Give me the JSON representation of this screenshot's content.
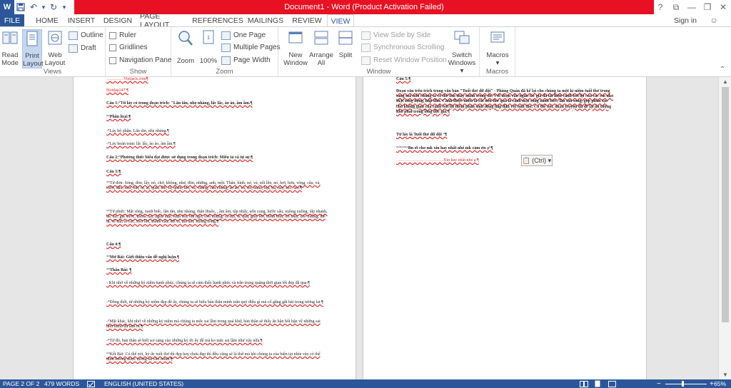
{
  "window": {
    "title": "Document1 - Word (Product Activation Failed)",
    "help": "?",
    "ribbon_display": "⧉",
    "minimize": "—",
    "restore": "❐",
    "close": "✕"
  },
  "qat": {
    "logo": "W",
    "save": "💾",
    "undo": "↶",
    "undo_menu": "▾",
    "redo": "↻",
    "customize": "▾"
  },
  "tabs": [
    "FILE",
    "HOME",
    "INSERT",
    "DESIGN",
    "PAGE LAYOUT",
    "REFERENCES",
    "MAILINGS",
    "REVIEW",
    "VIEW"
  ],
  "account": {
    "signin": "Sign in",
    "smiley": "☺"
  },
  "ribbon": {
    "views": {
      "label": "Views",
      "read_mode": [
        "Read",
        "Mode"
      ],
      "print_layout": [
        "Print",
        "Layout"
      ],
      "web_layout": [
        "Web",
        "Layout"
      ],
      "outline": "Outline",
      "draft": "Draft"
    },
    "show": {
      "label": "Show",
      "ruler": "Ruler",
      "gridlines": "Gridlines",
      "navigation_pane": "Navigation Pane"
    },
    "zoom": {
      "label": "Zoom",
      "zoom": "Zoom",
      "hundred": "100%",
      "one_page": "One Page",
      "multiple_pages": "Multiple Pages",
      "page_width": "Page Width"
    },
    "window": {
      "label": "Window",
      "new_window": [
        "New",
        "Window"
      ],
      "arrange_all": [
        "Arrange",
        "All"
      ],
      "split": "Split",
      "view_side_by_side": "View Side by Side",
      "sync_scrolling": "Synchronous Scrolling",
      "reset_window_position": "Reset Window Position",
      "switch_windows": [
        "Switch",
        "Windows ▾"
      ]
    },
    "macros": {
      "label": "Macros",
      "macros": [
        "Macros",
        "▾"
      ]
    },
    "collapse": "⌃"
  },
  "page1": [
    {
      "t": "…………Vietjack.com¶",
      "red": true
    },
    {
      "t": "Hoidap247 ¶",
      "red": true
    },
    {
      "t": "Câu 1:°Từ láy có trong đoạn trích: \"Lăn tăn, nhẹ nhàng, lấc lấc, ào ào, ầm ầm.¶",
      "b": true
    },
    {
      "t": "°°Phân loại:¶",
      "b": true
    },
    {
      "t": "-°Láy bộ phận: Lăn tăn, nhẹ nhàng.¶"
    },
    {
      "t": "-°Láy hoàn toàn: lấc lấc, ào ào, ầm ầm.¶"
    },
    {
      "t": "Câu 2:°Phương thức biểu đạt được sử dụng trong đoạn trích: Miêu tả và tự sự.¶",
      "b": true
    },
    {
      "t": "Câu 3:¶",
      "b": true
    },
    {
      "t": "°°Từ đơn: Sóng, đón, lấy, nó, chờ, không, như, đón, những, anh, một. Thân, hình, nó, và, nổi lên, nó, bơi, hơn, vòng, câu, và, cười, đầu, như, bắt, bị, ai, quất, thể, là, quên, hết, và, chẳng, cần,chúng, ào ào, và, thì, nhau, bại, ba, này, sóc, lao.¶"
    },
    {
      "t": "°°Từ phức: Mặt sông, xanh biếc, lăn tăn, nhẹ nhàng, thân thuộc, , ầm ầm, tấp nhẩy, uốn cong, bước sấu, xuồng xuồng, tấp nhanh, lấc lấc, giã nước, khoác tay, ngừa mặt, nhìn lên, bắt ngờ, toet miệng, cả dội, úc quá, giãy lên, thình lình, tơi mây, xảo xuồng, thể là, sợ hãi, ai cực, treo lên, thành cầu, hét to, ầm ầm, xuống sông.¶"
    },
    {
      "t": "Câu 4:¶",
      "b": true
    },
    {
      "t": "°°Mở Bài: Giới thiệu vấn đề nghị luận.¶",
      "b": true
    },
    {
      "t": "°°Thân Bài: ¶",
      "b": true
    },
    {
      "t": "- Khi nhớ về những kỷ niệm hạnh phúc, chúng ta sẽ cảm thấy hạnh phúc và trân trọng quãng thời gian tốt đẹp đã qua.¶"
    },
    {
      "t": "-°Đồng thời, từ những kỷ niệm đẹp đẽ ấy, chúng ta sẽ hiểu bản thân mình trân quý điều gì mà cố gắng gắt hài trong tương lai.¶"
    },
    {
      "t": "-°Mặt khác, khi nhớ về những kỷ niệm mà chúng ta mắc sai lầm trong quá khứ, bản thân sẽ thấy ân hận hối hận về những sai lầm mình đã làm ra.¶"
    },
    {
      "t": "-°Từ đó, bản thân sẽ biết soi sáng vào những kỷ ức ấy để mà ko mắc sai lầm như vậy nữa.¶"
    },
    {
      "t": "°°Kết Bài: Có thể nói, kỷ ức tuổi thơ dù đẹp hay chưa đẹp thì đều cũng sẽ là thứ mà khi chúng ta của biện tại nhìn vào có thể định hướng được tương lai cho mình.¶"
    }
  ],
  "page2": [
    {
      "t": "Câu 5:¶",
      "b": true
    },
    {
      "t": "Đoạn văn trên trích trong văn bản \"Tuổi thơ dữ dội\" - Phùng Quán đã kể lại cho chúng ta một kỉ niệm tuổi thơ trong sáng mà mỗi chúng ta có thể tìm thấy mình trong đó. Với đoạn văn ngắn tác giả đã tái hiện cảnh bơi lội của các em nhỏ thật sống động, hấp dẫn. Cảnh được miêu tả rất nên thơ qua là cảnh mặt sông xanh biếc, lăn tăn sóng, góp phần tạo cho không gian của cảnh bơi lội thêm phần sinh động hấp dẫn với tuổi thơ. Có thể nói, đoạn truyện đã để lại ấn tượng khó phai trong lòng độc giả.¶",
      "b": true
    },
    {
      "t": "Từ láy là Tuổi thơ dữ dội °¶",
      "b": true
    },
    {
      "t": "°°°°°°°Bn ơi cho mk xin hay nhất nhé mk cảm ơn ạ°¶",
      "b": true
    },
    {
      "t": "……………………………Xin hay nhất nhé ạ ¶",
      "red": true
    }
  ],
  "paste_options": "(Ctrl) ▾",
  "status": {
    "page": "PAGE 2 OF 2",
    "words": "479 WORDS",
    "language": "ENGLISH (UNITED STATES)",
    "zoom_out": "−",
    "zoom_in": "+",
    "zoom": "65%"
  }
}
